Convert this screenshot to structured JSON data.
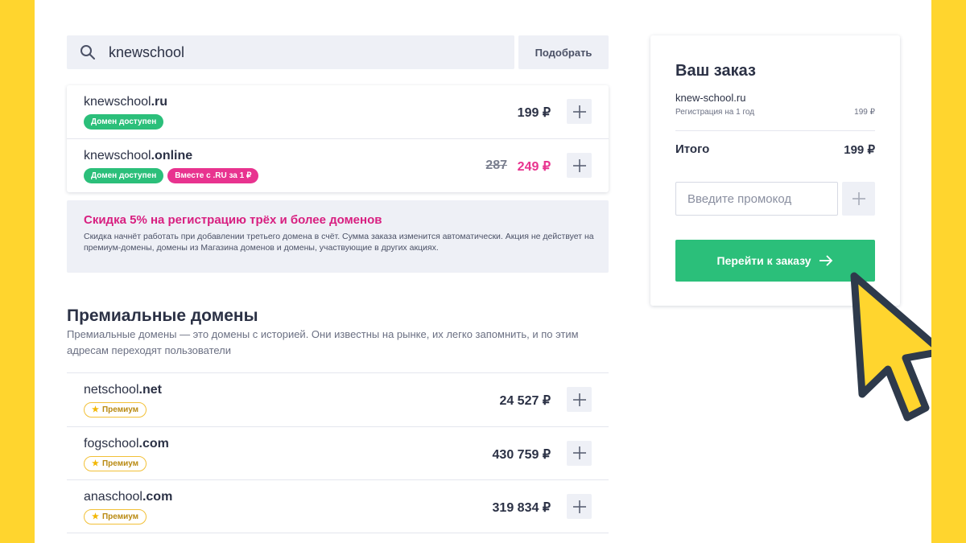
{
  "search": {
    "value": "knewschool",
    "button_label": "Подобрать"
  },
  "results": [
    {
      "name": "knewschool",
      "tld": ".ru",
      "badges": [
        "Домен доступен"
      ],
      "old_price": "",
      "price": "199 ₽"
    },
    {
      "name": "knewschool",
      "tld": ".online",
      "badges": [
        "Домен доступен",
        "Вместе с .RU за 1 ₽"
      ],
      "old_price": "287",
      "price": "249 ₽"
    }
  ],
  "promo_info": {
    "title": "Скидка 5% на регистрацию трёх и более доменов",
    "text": "Скидка начнёт работать при добавлении третьего домена в счёт. Сумма заказа изменится автоматически. Акция не действует на премиум-домены, домены из Магазина доменов и домены, участвующие в других акциях."
  },
  "premium": {
    "heading": "Премиальные домены",
    "description": "Премиальные домены — это домены с историей. Они известны на рынке, их легко запомнить, и по этим адресам переходят пользователи",
    "badge_label": "Премиум",
    "items": [
      {
        "name": "netschool",
        "tld": ".net",
        "price": "24 527 ₽"
      },
      {
        "name": "fogschool",
        "tld": ".com",
        "price": "430 759 ₽"
      },
      {
        "name": "anaschool",
        "tld": ".com",
        "price": "319 834 ₽"
      }
    ]
  },
  "order": {
    "title": "Ваш заказ",
    "domain": "knew-school.ru",
    "period": "Регистрация на 1 год",
    "period_price": "199 ₽",
    "total_label": "Итого",
    "total_value": "199 ₽",
    "promo_placeholder": "Введите промокод",
    "checkout_label": "Перейти к заказу"
  },
  "colors": {
    "background_frame": "#ffd52e",
    "accent_green": "#2bbf7a",
    "accent_pink": "#e8338f",
    "premium_gold": "#f2c037"
  },
  "icons": [
    "search-icon",
    "plus-icon",
    "arrow-right-icon",
    "star-icon",
    "cursor-pointer-icon"
  ]
}
